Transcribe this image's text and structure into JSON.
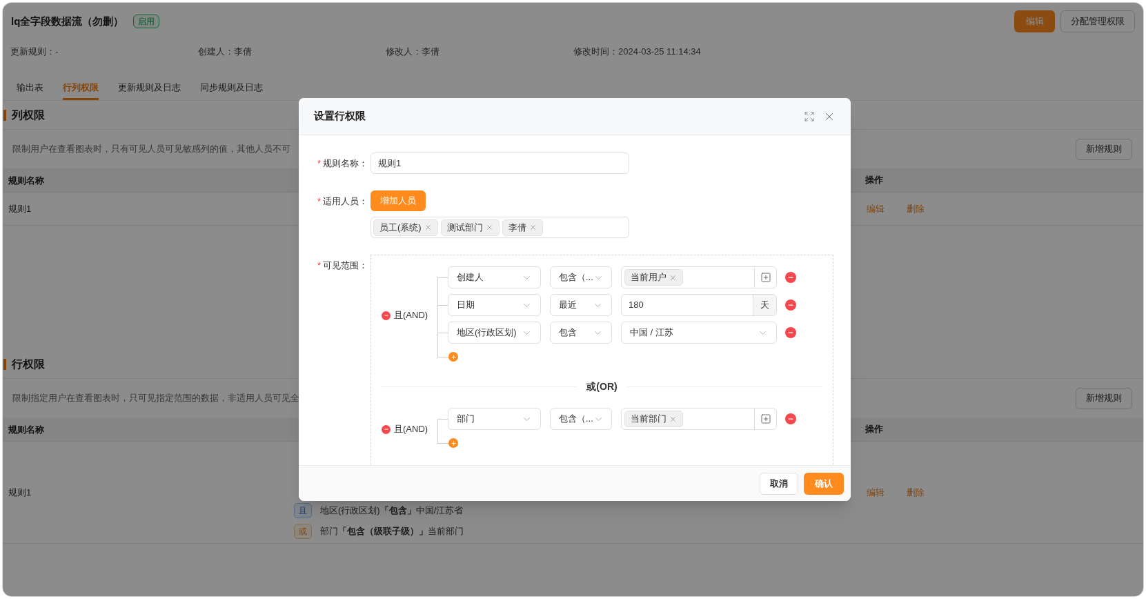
{
  "header": {
    "title": "lq全字段数据流（勿删）",
    "status": "启用",
    "actions": [
      {
        "label": "编辑",
        "kind": "primary"
      },
      {
        "label": "分配管理权限",
        "kind": "default"
      }
    ]
  },
  "meta": [
    {
      "label": "更新规则：",
      "value": "-"
    },
    {
      "label": "创建人：",
      "value": "李倩"
    },
    {
      "label": "修改人：",
      "value": "李倩"
    },
    {
      "label": "修改时间：",
      "value": "2024-03-25 11:14:34"
    }
  ],
  "tabs": [
    {
      "label": "输出表",
      "selected": false
    },
    {
      "label": "行列权限",
      "selected": true
    },
    {
      "label": "更新规则及日志",
      "selected": false
    },
    {
      "label": "同步规则及日志",
      "selected": false
    }
  ],
  "sections": [
    {
      "title": "列权限",
      "description": "限制用户在查看图表时，只有可见人员可见敏感列的值，其他人员不可",
      "add_button": "新增规则",
      "columns": {
        "name": "规则名称",
        "actions": "操作"
      },
      "rows": [
        {
          "name": "规则1",
          "conditions": [],
          "actions": [
            "编辑",
            "删除"
          ]
        }
      ]
    },
    {
      "title": "行权限",
      "description": "限制指定用户在查看图表时，只可见指定范围的数据，非适用人员可见全",
      "add_button": "新增规则",
      "columns": {
        "name": "规则名称",
        "actions": "操作"
      },
      "rows": [
        {
          "name": "规则1",
          "conditions": [
            {
              "kind": "and",
              "tag": "且",
              "text": "地区(行政区划)**「包含」**中国/江苏省"
            },
            {
              "kind": "or",
              "tag": "或",
              "text": "部门**「包含（级联子级）」**当前部门"
            }
          ],
          "actions": [
            "编辑",
            "删除"
          ]
        }
      ]
    }
  ],
  "dialog": {
    "title": "设置行权限",
    "rule_name": {
      "mark": "*",
      "label": "规则名称：",
      "value": "规则1"
    },
    "members": {
      "mark": "*",
      "label": "适用人员：",
      "button": "增加人员",
      "tags": [
        "员工(系统)",
        "测试部门",
        "李倩"
      ]
    },
    "scope": {
      "mark": "*",
      "label": "可见范围：",
      "separator": "或(OR)",
      "groups": [
        {
          "logic": "且(AND)",
          "conditions": [
            {
              "field": "创建人",
              "operator": "包含（...",
              "kind": "tags",
              "tags": [
                "当前用户"
              ]
            },
            {
              "field": "日期",
              "operator": "最近",
              "kind": "number",
              "value": "180",
              "suffix": "天"
            },
            {
              "field": "地区(行政区划)",
              "operator": "包含",
              "kind": "cascader",
              "value": "中国 / 江苏"
            }
          ]
        },
        {
          "logic": "且(AND)",
          "conditions": [
            {
              "field": "部门",
              "operator": "包含（...",
              "kind": "tags",
              "tags": [
                "当前部门"
              ]
            }
          ]
        }
      ]
    },
    "buttons": [
      {
        "label": "取消",
        "kind": "default"
      },
      {
        "label": "确认",
        "kind": "primary"
      }
    ]
  }
}
